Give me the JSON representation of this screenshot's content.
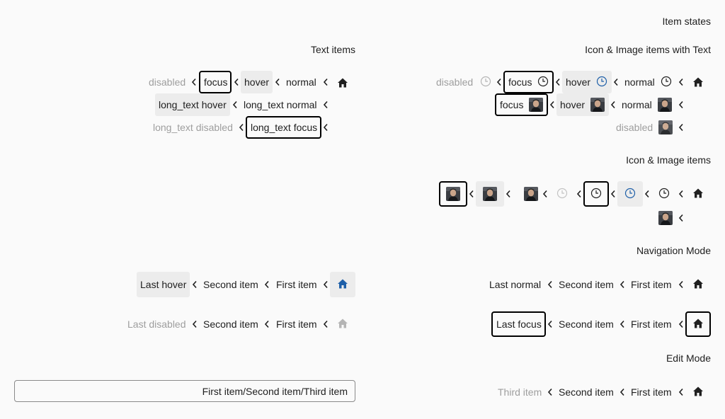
{
  "headings": {
    "item_states": "Item states",
    "text_items": "Text items",
    "icon_image_text": "Icon & Image items with Text",
    "icon_image": "Icon & Image items",
    "navigation_mode": "Navigation Mode",
    "edit_mode": "Edit Mode"
  },
  "text_items": {
    "disabled": "disabled",
    "focus": "focus",
    "hover": "hover",
    "normal": "normal",
    "long_hover": "long_text hover",
    "long_normal": "long_text normal",
    "long_disabled": "long_text disabled",
    "long_focus": "long_text focus"
  },
  "icon_text_items": {
    "disabled": "disabled",
    "focus": "focus",
    "hover": "hover",
    "normal": "normal"
  },
  "nav_left": {
    "row1": [
      "Last hover",
      "Second item",
      "First item"
    ],
    "row2": [
      "Last disabled",
      "Second item",
      "First item"
    ]
  },
  "nav_right": {
    "row1": [
      "Last normal",
      "Second item",
      "First item"
    ],
    "row2": [
      "Last focus",
      "Second item",
      "First item"
    ]
  },
  "edit_mode": {
    "path_value": "First item/Second item/Third item",
    "row": [
      "Third item",
      "Second item",
      "First item"
    ]
  },
  "icons": {
    "home": "home-icon",
    "clock": "clock-icon",
    "avatar": "avatar-image",
    "separator": "chevron-left-icon"
  },
  "colors": {
    "background": "#fafafa",
    "text": "#202020",
    "disabled": "#9e9e9e",
    "hover_bg": "#ececec",
    "accent_blue": "#1e5fa8",
    "focus_border": "#000000"
  }
}
